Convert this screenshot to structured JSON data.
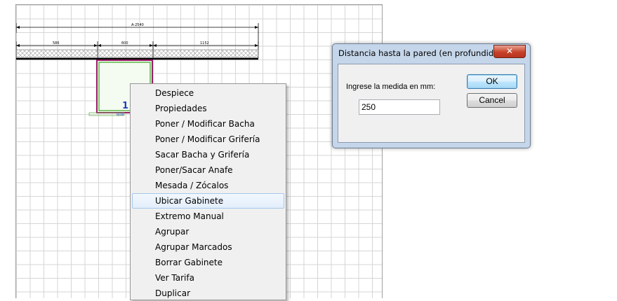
{
  "canvas": {
    "dimensions": {
      "total": "A-2540",
      "left_segment": "586",
      "middle_segment": "600",
      "right_segment": "1152"
    },
    "cabinet_number": "1",
    "cabinet_label": "BJ-80",
    "colors": {
      "cabinet_fill": "#f4fbf1",
      "cabinet_inner_border": "#5fb448",
      "cabinet_outer_border": "#9c1b6a",
      "number_color": "#1f3fbd"
    }
  },
  "context_menu": {
    "items": [
      {
        "label": "Despiece"
      },
      {
        "label": "Propiedades"
      },
      {
        "label": "Poner / Modificar Bacha"
      },
      {
        "label": "Poner / Modificar Grifería"
      },
      {
        "label": "Sacar Bacha y Grifería"
      },
      {
        "label": "Poner/Sacar Anafe"
      },
      {
        "label": "Mesada / Zócalos"
      },
      {
        "label": "Ubicar Gabinete",
        "hovered": true
      },
      {
        "label": "Extremo Manual"
      },
      {
        "label": "Agrupar"
      },
      {
        "label": "Agrupar Marcados"
      },
      {
        "label": "Borrar Gabinete"
      },
      {
        "label": "Ver Tarifa"
      },
      {
        "label": "Duplicar"
      }
    ]
  },
  "dialog": {
    "title": "Distancia hasta la pared (en profundida...",
    "close_label": "✕",
    "prompt_label": "Ingrese la medida en mm:",
    "input_value": "250",
    "ok_label": "OK",
    "cancel_label": "Cancel"
  }
}
